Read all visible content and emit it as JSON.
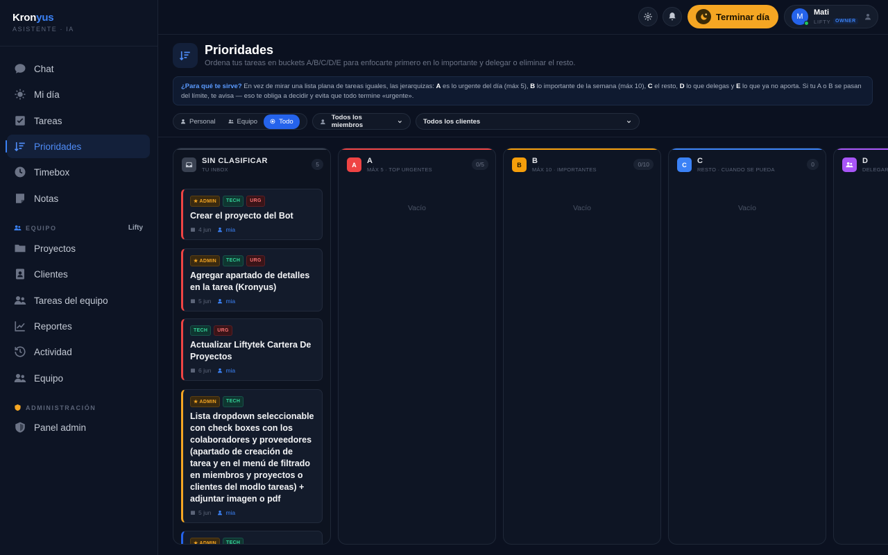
{
  "brand": {
    "name_a": "Kron",
    "name_b": "yus",
    "subtitle": "ASISTENTE · IA"
  },
  "sidebar": {
    "items": [
      {
        "label": "Chat",
        "icon": "chat-icon"
      },
      {
        "label": "Mi día",
        "icon": "sun-icon"
      },
      {
        "label": "Tareas",
        "icon": "check-square-icon"
      },
      {
        "label": "Prioridades",
        "icon": "sort-icon",
        "active": true
      },
      {
        "label": "Timebox",
        "icon": "clock-icon"
      },
      {
        "label": "Notas",
        "icon": "note-icon"
      }
    ],
    "team_section": {
      "label": "EQUIPO",
      "workspace": "Lifty"
    },
    "team_items": [
      {
        "label": "Proyectos",
        "icon": "folder-icon"
      },
      {
        "label": "Clientes",
        "icon": "contacts-icon"
      },
      {
        "label": "Tareas del equipo",
        "icon": "team-icon"
      },
      {
        "label": "Reportes",
        "icon": "chart-icon"
      },
      {
        "label": "Actividad",
        "icon": "history-icon"
      },
      {
        "label": "Equipo",
        "icon": "users-icon"
      }
    ],
    "admin_section": {
      "label": "ADMINISTRACIÓN"
    },
    "admin_items": [
      {
        "label": "Panel admin",
        "icon": "shield-icon"
      }
    ]
  },
  "topbar": {
    "end_day": "Terminar día",
    "user": {
      "initial": "M",
      "name": "Mati",
      "org": "LIFTY",
      "role": "OWNER"
    }
  },
  "page": {
    "title": "Prioridades",
    "subtitle": "Ordena tus tareas en buckets A/B/C/D/E para enfocarte primero en lo importante y delegar o eliminar el resto.",
    "info": {
      "q": "¿Para qué te sirve?",
      "p1": " En vez de mirar una lista plana de tareas iguales, las jerarquizas: ",
      "a": "A",
      "p2": " es lo urgente del día (máx 5), ",
      "b": "B",
      "p3": " lo importante de la semana (máx 10), ",
      "c": "C",
      "p4": " el resto, ",
      "d": "D",
      "p5": " lo que delegas y ",
      "e": "E",
      "p6": " lo que ya no aporta. Si tu A o B se pasan del límite, te avisa — eso te obliga a decidir y evita que todo termine «urgente»."
    }
  },
  "filters": {
    "scope": [
      "Personal",
      "Equipo",
      "Todo"
    ],
    "scope_selected": "Todo",
    "members": "Todos los miembros",
    "clients": "Todos los clientes"
  },
  "columns": [
    {
      "name": "SIN CLASIFICAR",
      "sub": "TU INBOX",
      "count": "5"
    },
    {
      "name": "A",
      "sub": "MÁX 5 · TOP URGENTES",
      "count": "0/5",
      "empty": "Vacío",
      "color": "#ef4444"
    },
    {
      "name": "B",
      "sub": "MÁX 10 · IMPORTANTES",
      "count": "0/10",
      "empty": "Vacío",
      "color": "#f59e0b"
    },
    {
      "name": "C",
      "sub": "RESTO · CUANDO SE PUEDA",
      "count": "0",
      "empty": "Vacío",
      "color": "#3b82f6"
    },
    {
      "name": "D",
      "sub": "DELEGAR",
      "count": "",
      "color": "#a855f7"
    }
  ],
  "cards": [
    {
      "tags": [
        "★ ADMIN",
        "TECH",
        "URG"
      ],
      "title": "Crear el proyecto del Bot",
      "date": "4 jun",
      "assignee": "mia",
      "accent": "#ef4444"
    },
    {
      "tags": [
        "★ ADMIN",
        "TECH",
        "URG"
      ],
      "title": "Agregar apartado de detalles en la tarea (Kronyus)",
      "date": "5 jun",
      "assignee": "mia",
      "accent": "#ef4444"
    },
    {
      "tags": [
        "TECH",
        "URG"
      ],
      "title": "Actualizar Liftytek Cartera De Proyectos",
      "date": "6 jun",
      "assignee": "mia",
      "accent": "#ef4444"
    },
    {
      "tags": [
        "★ ADMIN",
        "TECH"
      ],
      "title": "Lista dropdown seleccionable con check boxes con los colaboradores y proveedores (apartado de creación de tarea y en el menú de filtrado en miembros y proyectos o clientes del modlo tareas) + adjuntar imagen o pdf",
      "date": "5 jun",
      "assignee": "mia",
      "accent": "#f5a623"
    },
    {
      "tags": [
        "★ ADMIN",
        "TECH"
      ],
      "title": "",
      "date": "",
      "assignee": "",
      "accent": "#2563eb"
    }
  ]
}
